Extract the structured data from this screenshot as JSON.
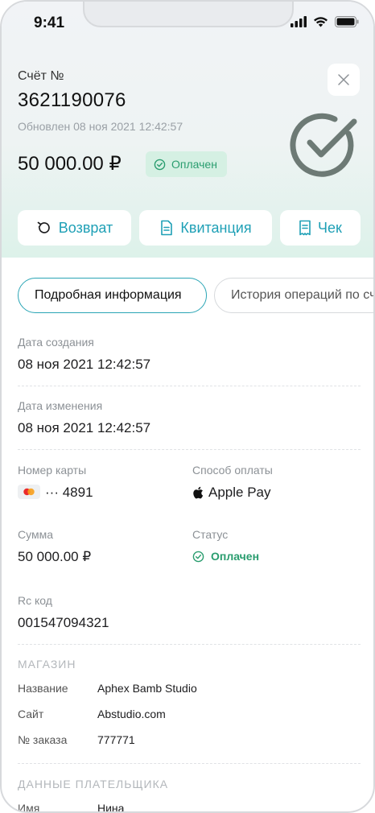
{
  "status_bar": {
    "time": "9:41"
  },
  "header": {
    "invoice_label": "Счёт №",
    "invoice_number": "3621190076",
    "updated": "Обновлен 08 ноя 2021 12:42:57",
    "amount": "50 000.00 ₽",
    "status_badge": "Оплачен"
  },
  "actions": {
    "refund": "Возврат",
    "receipt": "Квитанция",
    "check": "Чек"
  },
  "tabs": {
    "details": "Подробная информация",
    "history": "История операций по счёту"
  },
  "details": {
    "created_label": "Дата создания",
    "created_value": "08 ноя 2021 12:42:57",
    "modified_label": "Дата изменения",
    "modified_value": "08 ноя 2021 12:42:57",
    "card_label": "Номер карты",
    "card_value": "··· 4891",
    "payment_method_label": "Способ оплаты",
    "payment_method_value": "Apple Pay",
    "sum_label": "Сумма",
    "sum_value": "50 000.00 ₽",
    "status_label": "Статус",
    "status_value": "Оплачен",
    "rc_label": "Rc код",
    "rc_value": "001547094321"
  },
  "shop": {
    "title": "МАГАЗИН",
    "name_key": "Название",
    "name_value": "Aphex Bamb Studio",
    "site_key": "Сайт",
    "site_value": "Abstudio.com",
    "order_key": "№ заказа",
    "order_value": "777771"
  },
  "payer": {
    "title": "ДАННЫЕ ПЛАТЕЛЬЩИКА",
    "name_key": "Имя",
    "name_value": "Нина"
  },
  "colors": {
    "accent": "#1fa0b6",
    "success": "#2a9d6f",
    "success_bg": "#d5f0e3"
  }
}
